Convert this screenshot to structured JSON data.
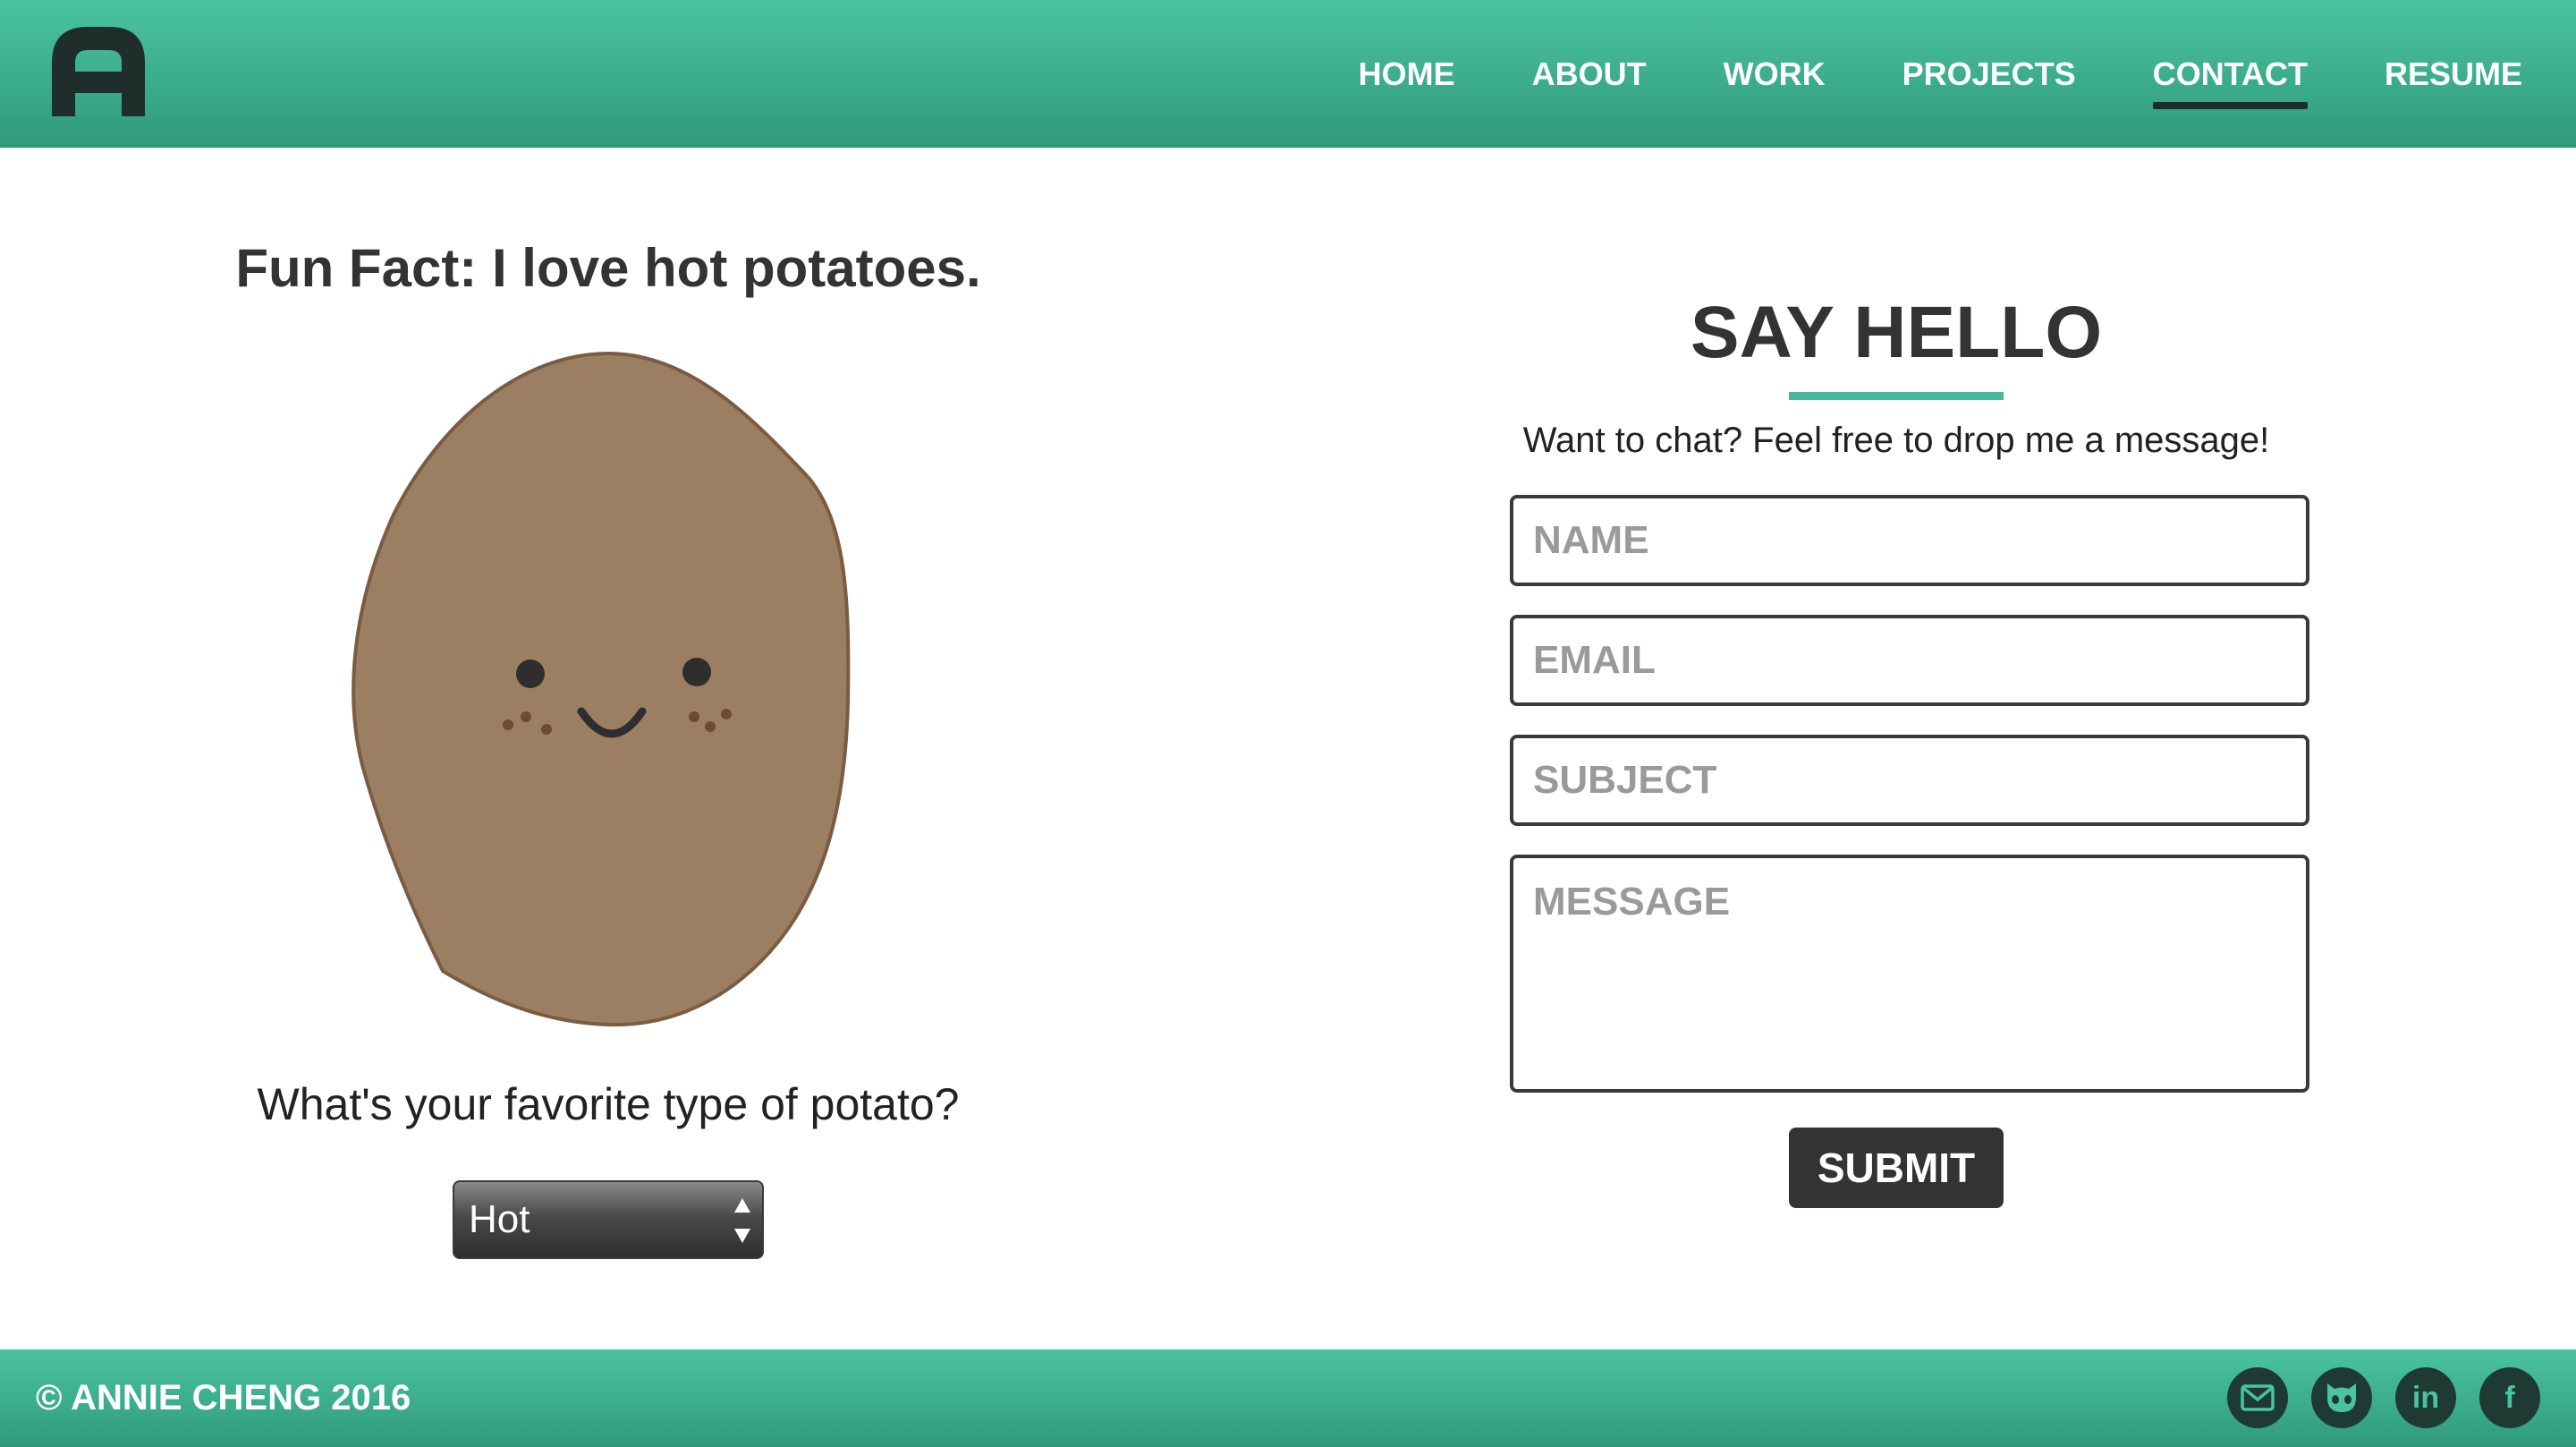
{
  "header": {
    "logo_letter": "A",
    "nav": [
      {
        "label": "HOME",
        "active": false
      },
      {
        "label": "ABOUT",
        "active": false
      },
      {
        "label": "WORK",
        "active": false
      },
      {
        "label": "PROJECTS",
        "active": false
      },
      {
        "label": "CONTACT",
        "active": true
      },
      {
        "label": "RESUME",
        "active": false
      }
    ]
  },
  "left": {
    "fun_fact": "Fun Fact: I love hot potatoes.",
    "question": "What's your favorite type of potato?",
    "select_value": "Hot"
  },
  "contact": {
    "title": "SAY HELLO",
    "intro": "Want to chat? Feel free to drop me a message!",
    "name_placeholder": "NAME",
    "email_placeholder": "EMAIL",
    "subject_placeholder": "SUBJECT",
    "message_placeholder": "MESSAGE",
    "submit_label": "SUBMIT"
  },
  "footer": {
    "copyright": "© ANNIE CHENG 2016",
    "socials": [
      {
        "name": "email-icon"
      },
      {
        "name": "github-icon"
      },
      {
        "name": "linkedin-icon",
        "glyph": "in"
      },
      {
        "name": "facebook-icon",
        "glyph": "f"
      }
    ]
  },
  "colors": {
    "accent": "#43b99a",
    "header_top": "#4bc4a0",
    "header_bottom": "#2f9a7a",
    "dark": "#333333",
    "potato": "#9c7f62",
    "potato_outline": "#7a5c42"
  }
}
